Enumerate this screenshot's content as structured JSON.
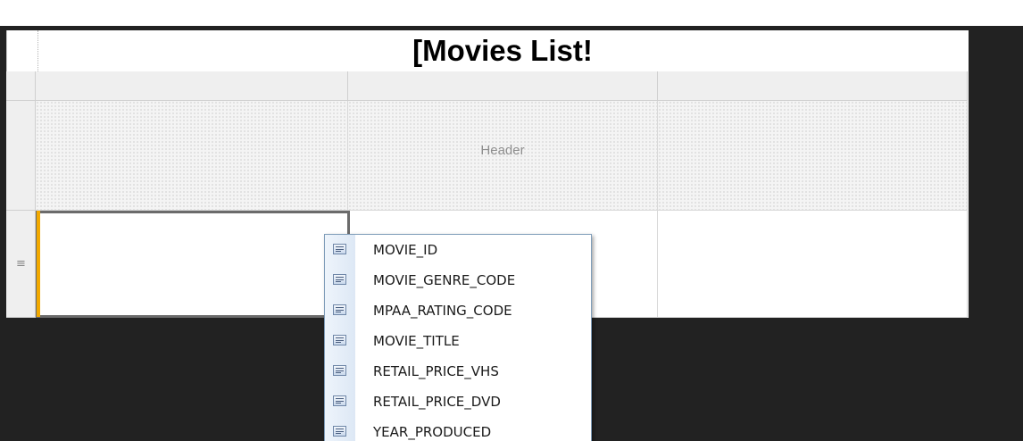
{
  "report": {
    "title": "[Movies List!"
  },
  "tablix": {
    "columns": 3,
    "header_row": {
      "cells": [
        "",
        "Header",
        ""
      ]
    },
    "detail_row": {
      "row_handle_icon": "≡",
      "cells": [
        "",
        "",
        ""
      ]
    }
  },
  "field_list": {
    "items": [
      {
        "label": "MOVIE_ID",
        "icon": "field-icon"
      },
      {
        "label": "MOVIE_GENRE_CODE",
        "icon": "field-icon"
      },
      {
        "label": "MPAA_RATING_CODE",
        "icon": "field-icon"
      },
      {
        "label": "MOVIE_TITLE",
        "icon": "field-icon"
      },
      {
        "label": "RETAIL_PRICE_VHS",
        "icon": "field-icon"
      },
      {
        "label": "RETAIL_PRICE_DVD",
        "icon": "field-icon"
      },
      {
        "label": "YEAR_PRODUCED",
        "icon": "field-icon"
      }
    ]
  },
  "colors": {
    "surface": "#222222",
    "selection_marker": "#f2a900",
    "selected_border": "#6b6b6b",
    "dropdown_border": "#7f9db9"
  }
}
